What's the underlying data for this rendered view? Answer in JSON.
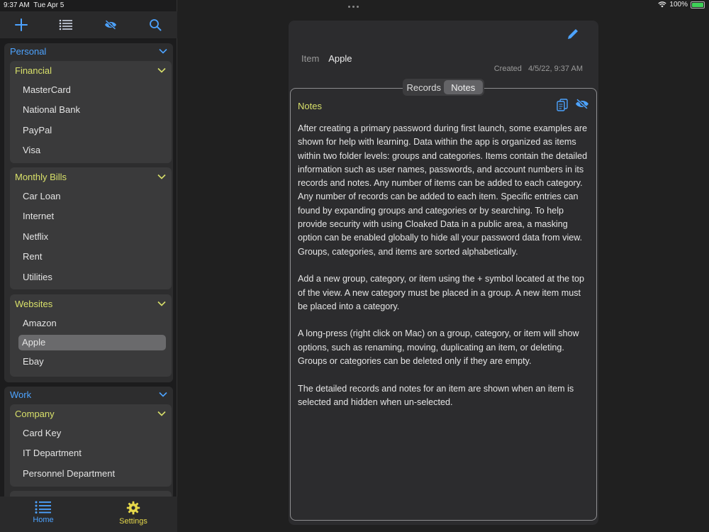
{
  "status": {
    "time": "9:37 AM",
    "date": "Tue Apr 5",
    "battery": "100%"
  },
  "colors": {
    "accent": "#4da3ff",
    "category": "#d8e06a",
    "tab_settings": "#e6d84a"
  },
  "toolbar": {
    "icons": [
      "plus-icon",
      "list-icon",
      "eye-slash-icon",
      "search-icon"
    ]
  },
  "groups": [
    {
      "name": "Personal",
      "categories": [
        {
          "name": "Financial",
          "items": [
            "MasterCard",
            "National Bank",
            "PayPal",
            "Visa"
          ]
        },
        {
          "name": "Monthly Bills",
          "items": [
            "Car Loan",
            "Internet",
            "Netflix",
            "Rent",
            "Utilities"
          ]
        },
        {
          "name": "Websites",
          "items": [
            "Amazon",
            "Apple",
            "Ebay"
          ],
          "selected": "Apple"
        }
      ]
    },
    {
      "name": "Work",
      "categories": [
        {
          "name": "Company",
          "items": [
            "Card Key",
            "IT Department",
            "Personnel Department"
          ]
        }
      ]
    }
  ],
  "tabs": {
    "home": "Home",
    "settings": "Settings"
  },
  "detail": {
    "item_label": "Item",
    "item_value": "Apple",
    "created_label": "Created",
    "created_value": "4/5/22, 9:37 AM",
    "segments": {
      "records": "Records",
      "notes": "Notes",
      "active": "Notes"
    },
    "notes_title": "Notes",
    "notes_paragraphs": [
      "After creating a primary password during first launch, some examples are shown for help with learning. Data within the app is organized as items within two folder levels: groups and categories. Items contain the detailed information such as user names, passwords, and account numbers in its records and notes. Any number of items can be added to each category. Any number of records can be added to each item. Specific entries can found by expanding groups and categories or by searching. To help provide security with using Cloaked Data in a public area, a masking option can be enabled globally to hide all your password data from view. Groups, categories, and items are sorted alphabetically.",
      "Add a new group, category, or item using the + symbol located at the top of the view. A new category must be placed in a group. A new item must be placed into a category.",
      "A long-press (right click on Mac) on a group, category, or item will show options, such as renaming, moving, duplicating an item, or deleting. Groups or categories can be deleted only if they are empty.",
      "The detailed records and notes for an item are shown when an item is selected and hidden when un-selected."
    ]
  }
}
